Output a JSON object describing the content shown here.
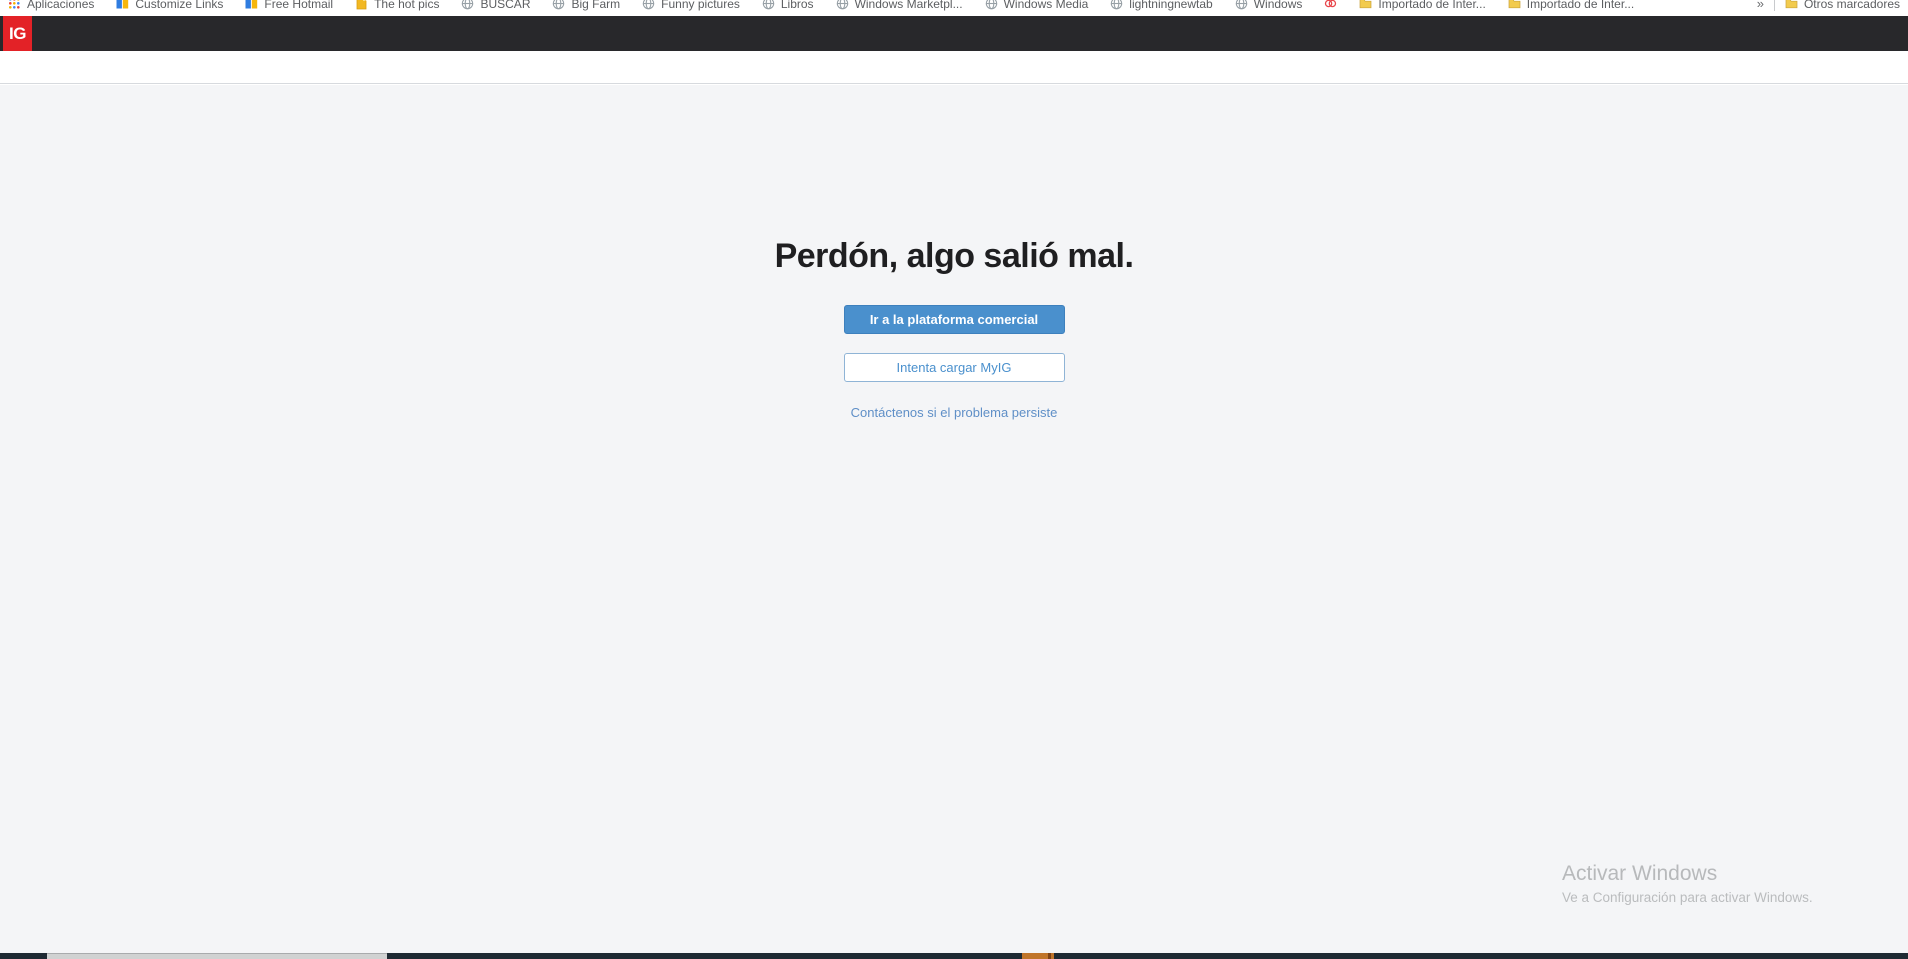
{
  "bookmarks_bar": {
    "items": [
      {
        "label": "Aplicaciones",
        "icon": "apps-grid"
      },
      {
        "label": "Customize Links",
        "icon": "ie-blue-yellow"
      },
      {
        "label": "Free Hotmail",
        "icon": "ie-blue-yellow"
      },
      {
        "label": "The hot pics",
        "icon": "yellow-page"
      },
      {
        "label": "BUSCAR",
        "icon": "globe"
      },
      {
        "label": "Big Farm",
        "icon": "globe"
      },
      {
        "label": "Funny pictures",
        "icon": "globe"
      },
      {
        "label": "Libros",
        "icon": "globe"
      },
      {
        "label": "Windows Marketpl...",
        "icon": "globe"
      },
      {
        "label": "Windows Media",
        "icon": "globe"
      },
      {
        "label": "lightningnewtab",
        "icon": "globe"
      },
      {
        "label": "Windows",
        "icon": "globe"
      },
      {
        "label": "",
        "icon": "airbnb"
      },
      {
        "label": "Importado de Inter...",
        "icon": "folder"
      },
      {
        "label": "Importado de Inter...",
        "icon": "folder"
      }
    ],
    "overflow_chevron": "»",
    "other_bookmarks": {
      "label": "Otros marcadores",
      "icon": "folder"
    }
  },
  "header": {
    "logo_text": "IG"
  },
  "main": {
    "title": "Perdón, algo salió mal.",
    "primary_button_label": "Ir a la plataforma comercial",
    "secondary_button_label": "Intenta cargar MyIG",
    "contact_link_label": "Contáctenos si el problema persiste"
  },
  "watermark": {
    "title": "Activar Windows",
    "subtitle": "Ve a Configuración para activar Windows."
  },
  "colors": {
    "accent_blue": "#4a90cd",
    "link_blue": "#5f8fc7",
    "logo_red": "#e32227",
    "header_dark": "#28282b",
    "page_bg": "#f4f5f7",
    "bottom_bar_dark": "#1e2a33",
    "bottom_bar_orange": "#c0752a",
    "title_text": "#1f1f21"
  }
}
